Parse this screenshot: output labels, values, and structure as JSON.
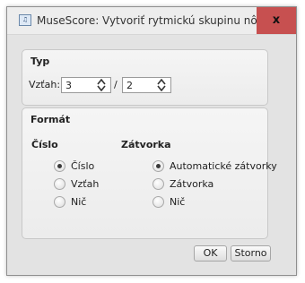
{
  "window": {
    "title": "MuseScore: Vytvoriť rytmickú skupinu nôt",
    "icon": "musescore-app-icon",
    "close_glyph": "x"
  },
  "typ": {
    "title": "Typ",
    "ratio_label": "Vzťah:",
    "numerator": "3",
    "separator": "/",
    "denominator": "2"
  },
  "format": {
    "title": "Formát",
    "number_column": {
      "title": "Číslo",
      "options": [
        {
          "label": "Číslo",
          "selected": true
        },
        {
          "label": "Vzťah",
          "selected": false
        },
        {
          "label": "Nič",
          "selected": false
        }
      ]
    },
    "bracket_column": {
      "title": "Zátvorka",
      "options": [
        {
          "label": "Automatické zátvorky",
          "selected": true
        },
        {
          "label": "Zátvorka",
          "selected": false
        },
        {
          "label": "Nič",
          "selected": false
        }
      ]
    }
  },
  "buttons": {
    "ok": "OK",
    "cancel": "Storno"
  },
  "colors": {
    "close_button": "#c75050",
    "dialog_background": "#e3e3e3"
  }
}
